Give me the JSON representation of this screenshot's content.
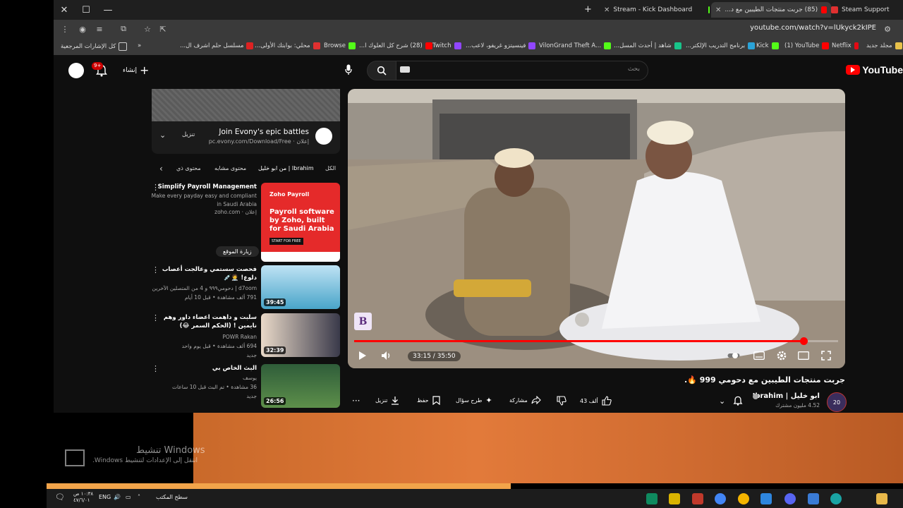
{
  "window_controls": {
    "close": "✕",
    "maximize": "☐",
    "minimize": "—"
  },
  "tabs": [
    {
      "label": "Steam Support"
    },
    {
      "label": "(85) جربت منتجات الطيبين مع د..."
    },
    {
      "label": "Stream - Kick Dashboard"
    }
  ],
  "address": {
    "url": "youtube.com/watch?v=lUkyck2kIPE"
  },
  "bookmarks": {
    "items": [
      "مجلد جديد",
      "Netflix",
      "(1) YouTube",
      "Kick",
      "برنامج التدريب الإلكتر...",
      "شاهد | أحدث المسل...",
      "VilonGrand Theft A...",
      "فينسيتزو غريفو، لاعب...",
      "Twitch",
      "(28) شرح كل العلوك ا...",
      "Browse",
      "محلي: بوابتك الأولى...",
      "مسلسل حلم اشرف ال..."
    ],
    "more": "»",
    "all_bookmarks": "كل الإشارات المرجعية"
  },
  "youtube": {
    "logo": "YouTube",
    "search_placeholder": "بحث",
    "create_label": "إنشاء",
    "notif_badge": "9+"
  },
  "player": {
    "time": "33:15 / 35:50",
    "progress": 0.928,
    "watermark": "B"
  },
  "video": {
    "title": "جربت منتجات الطيبين مع دحومي 999 🔥.",
    "channel": "ابو خليل | Ibrahim",
    "subscribers": "4.52 مليون مشترك",
    "channel_avatar": "20",
    "actions": {
      "likes": "43 ألف",
      "share": "مشاركة",
      "ask": "طرح سؤال",
      "save": "حفظ",
      "download": "تنزيل"
    }
  },
  "ad": {
    "title": "Join Evony's epic battles",
    "url": "إعلان · pc.evony.com/Download/Free",
    "cta": "تنزيل"
  },
  "chips": [
    "الكل",
    "من ابو خليل | Ibrahim",
    "محتوى مشابه",
    "محتوى ذي"
  ],
  "sidebar": [
    {
      "title": "Simplify Payroll Management",
      "meta1": "Make every payday easy and compliant in Saudi Arabia",
      "meta2": "إعلان · zoho.com",
      "button": "زيارة الموقع",
      "thumb_title": "Payroll software by Zoho, built for Saudi Arabia",
      "thumb_brand": "Zoho Payroll",
      "thumb_cta": "START FOR FREE"
    },
    {
      "title": "فحصت سستمي وعالجت أعصاب دلوع! 🧑‍⚕️💉",
      "meta1": "d7oom | دحومي٩٩٩ و 4 من المتصلين الآخرين",
      "meta2": "791 ألف مشاهدة • قبل 10 أيام",
      "duration": "39:45"
    },
    {
      "title": "سلبت و داهمت اعضاء داور وهم نايمين ! (الحكم السمر 😂)",
      "meta1": "POWR Rakan",
      "meta2": "694 ألف مشاهدة • قبل يوم واحد",
      "meta3": "جديد",
      "duration": "32:39"
    },
    {
      "title": "البث الخاص بي",
      "meta1": "يوسف",
      "meta2": "36 مشاهدة • تم البث قبل 10 ساعات",
      "meta3": "جديد",
      "duration": "26:56"
    }
  ],
  "desktop": {
    "activate_title": "تنشيط Windows",
    "activate_sub": "انتقل إلى الإعدادات لتنشيط Windows."
  },
  "taskbar": {
    "time": "١٠:٣٨ ص",
    "date": "٤٧/٦/٠١",
    "lang": "ENG",
    "desktop_label": "سطح المكتب"
  }
}
